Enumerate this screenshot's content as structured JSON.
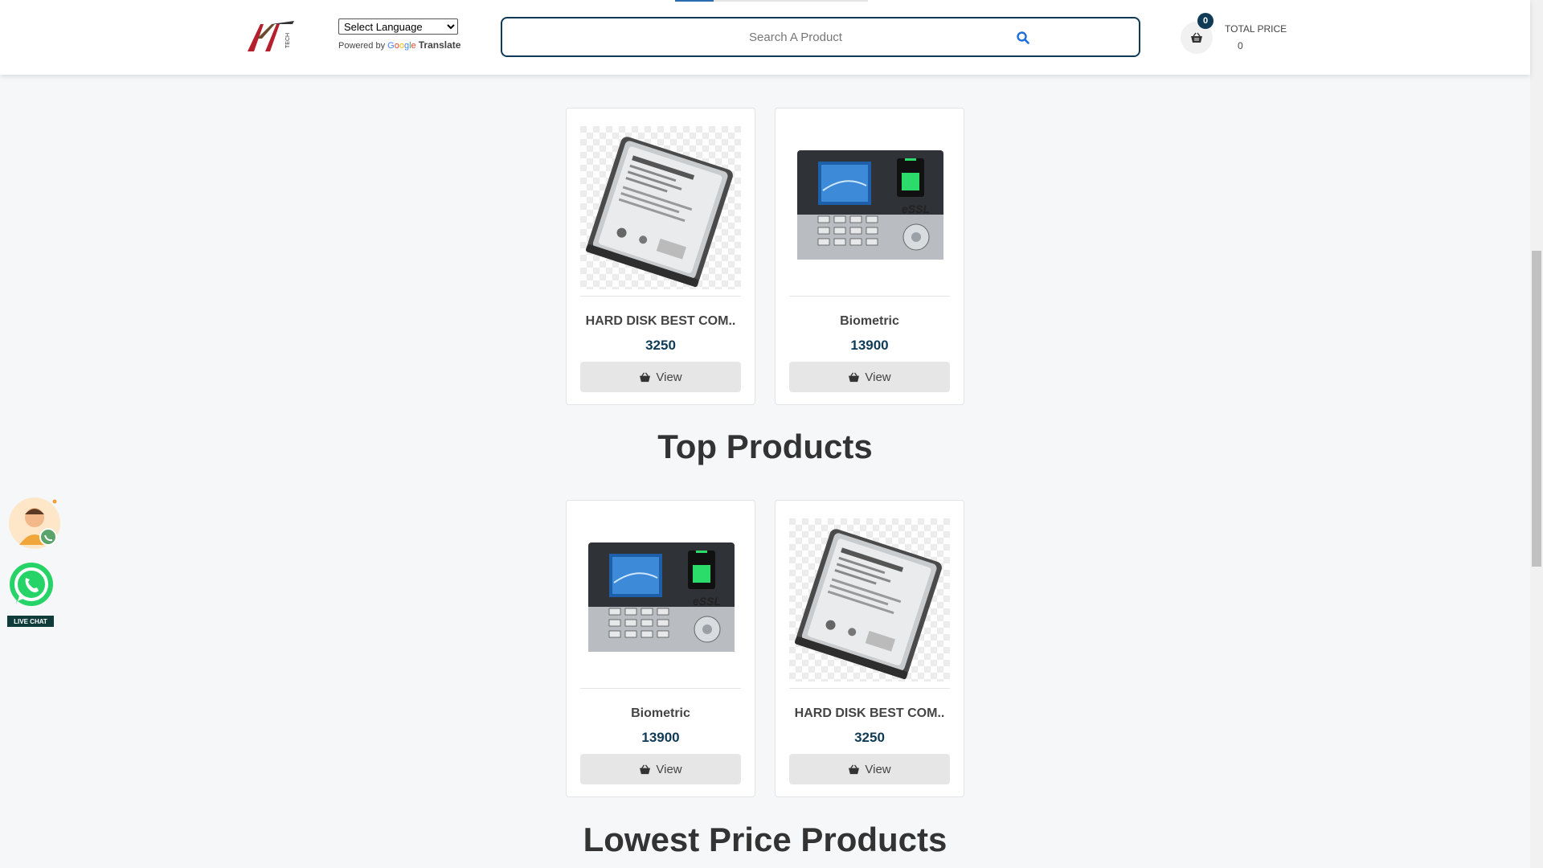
{
  "header": {
    "language_select": {
      "selected": "Select Language"
    },
    "powered_by": {
      "prefix": "Powered by",
      "brand_letters": [
        "G",
        "o",
        "o",
        "g",
        "l",
        "e"
      ],
      "suffix": "Translate"
    },
    "search": {
      "placeholder": "Search A Product",
      "value": ""
    },
    "cart": {
      "count": "0",
      "total_label": "TOTAL PRICE",
      "total_value": "0"
    }
  },
  "products_row1": [
    {
      "name": "HARD DISK BEST COM..",
      "price": "3250",
      "view_label": "View",
      "image": "hard-disk"
    },
    {
      "name": "Biometric",
      "price": "13900",
      "view_label": "View",
      "image": "biometric"
    }
  ],
  "top_products": {
    "title": "Top Products",
    "items": [
      {
        "name": "Biometric",
        "price": "13900",
        "view_label": "View",
        "image": "biometric"
      },
      {
        "name": "HARD DISK BEST COM..",
        "price": "3250",
        "view_label": "View",
        "image": "hard-disk"
      }
    ]
  },
  "lowest_price": {
    "title": "Lowest Price Products"
  },
  "widgets": {
    "live_chat_label": "LIVE CHAT"
  },
  "colors": {
    "brand_dark": "#0f3b57",
    "whatsapp_green": "#25d366",
    "background": "#f5f7f9"
  }
}
